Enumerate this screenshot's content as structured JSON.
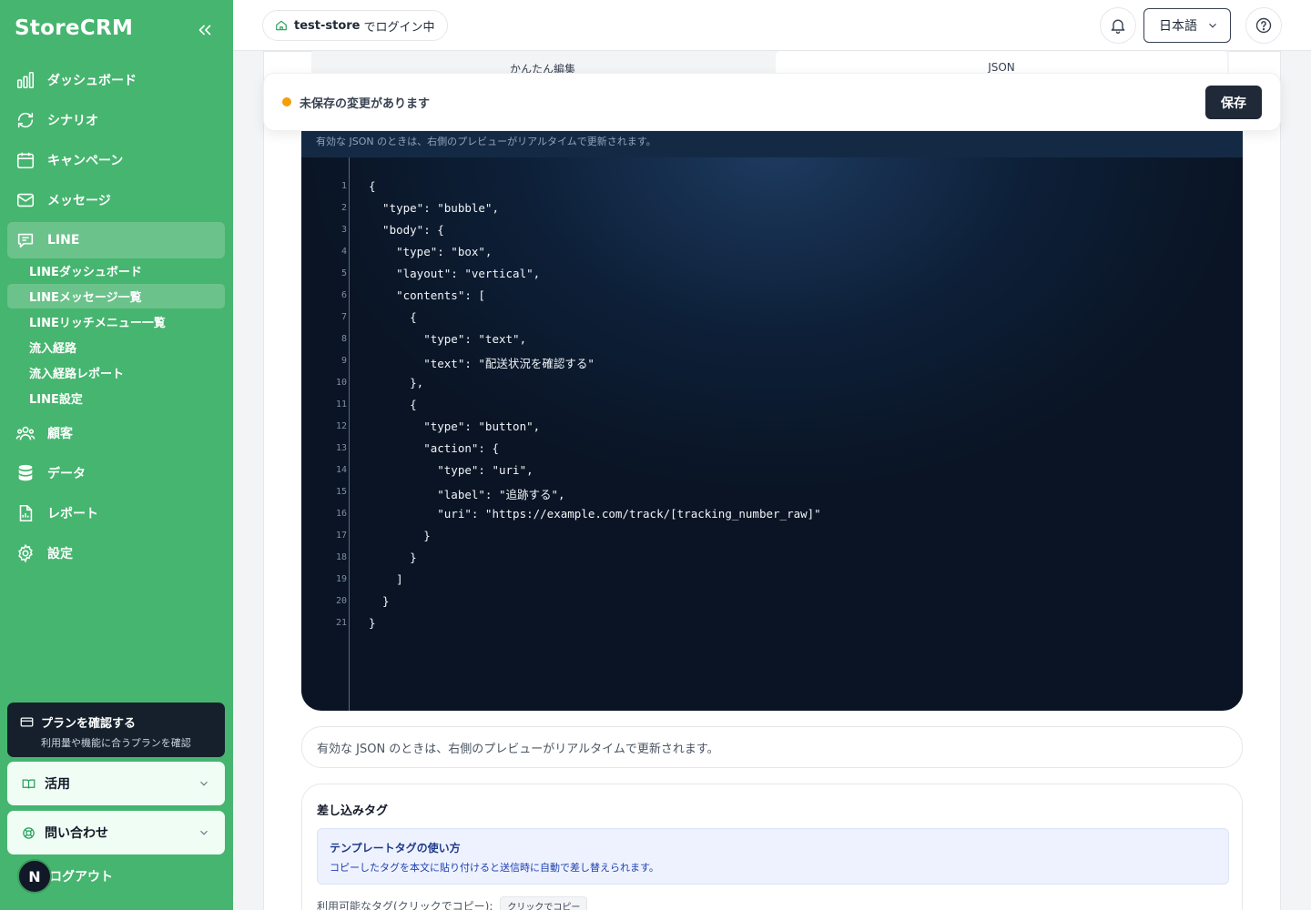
{
  "brand": "StoreCRM",
  "sidebar": {
    "nav": [
      {
        "label": "ダッシュボード",
        "icon": "chart-bar-icon"
      },
      {
        "label": "シナリオ",
        "icon": "refresh-icon"
      },
      {
        "label": "キャンペーン",
        "icon": "calendar-icon"
      },
      {
        "label": "メッセージ",
        "icon": "mail-icon"
      },
      {
        "label": "LINE",
        "icon": "chat-bubble-icon"
      },
      {
        "label": "顧客",
        "icon": "users-icon"
      },
      {
        "label": "データ",
        "icon": "database-icon"
      },
      {
        "label": "レポート",
        "icon": "file-chart-icon"
      },
      {
        "label": "設定",
        "icon": "gear-icon"
      }
    ],
    "line_sub": [
      {
        "label": "LINEダッシュボード"
      },
      {
        "label": "LINEメッセージ一覧"
      },
      {
        "label": "LINEリッチメニュー一覧"
      },
      {
        "label": "流入経路"
      },
      {
        "label": "流入経路レポート"
      },
      {
        "label": "LINE設定"
      }
    ],
    "plan": {
      "title": "プランを確認する",
      "subtitle": "利用量や機能に合うプランを確認"
    },
    "accordions": [
      {
        "label": "活用",
        "icon": "book-icon"
      },
      {
        "label": "問い合わせ",
        "icon": "support-icon"
      }
    ],
    "avatar_initial": "N",
    "logout": "ログアウト"
  },
  "header": {
    "store": "test-store",
    "login_suffix": "でログイン中",
    "language": "日本語"
  },
  "tabs": [
    {
      "label": "かんたん編集"
    },
    {
      "label": "JSON"
    }
  ],
  "unsaved": {
    "text": "未保存の変更があります",
    "save": "保存"
  },
  "editor": {
    "hint": "有効な JSON のときは、右側のプレビューがリアルタイムで更新されます。",
    "line_numbers": [
      "1",
      "2",
      "3",
      "4",
      "5",
      "6",
      "7",
      "8",
      "9",
      "10",
      "11",
      "12",
      "13",
      "14",
      "15",
      "16",
      "17",
      "18",
      "19",
      "20",
      "21"
    ],
    "lines": [
      "{",
      "  \"type\": \"bubble\",",
      "  \"body\": {",
      "    \"type\": \"box\",",
      "    \"layout\": \"vertical\",",
      "    \"contents\": [",
      "      {",
      "        \"type\": \"text\",",
      "        \"text\": \"配送状況を確認する\"",
      "      },",
      "      {",
      "        \"type\": \"button\",",
      "        \"action\": {",
      "          \"type\": \"uri\",",
      "          \"label\": \"追跡する\",",
      "          \"uri\": \"https://example.com/track/[tracking_number_raw]\"",
      "        }",
      "      }",
      "    ]",
      "  }",
      "}"
    ]
  },
  "hint_box": "有効な JSON のときは、右側のプレビューがリアルタイムで更新されます。",
  "tags": {
    "title": "差し込みタグ",
    "tip_title": "テンプレートタグの使い方",
    "tip_body": "コピーしたタグを本文に貼り付けると送信時に自動で差し替えられます。",
    "available": "利用可能なタグ(クリックでコピー):",
    "copy_chip": "クリックでコピー"
  }
}
